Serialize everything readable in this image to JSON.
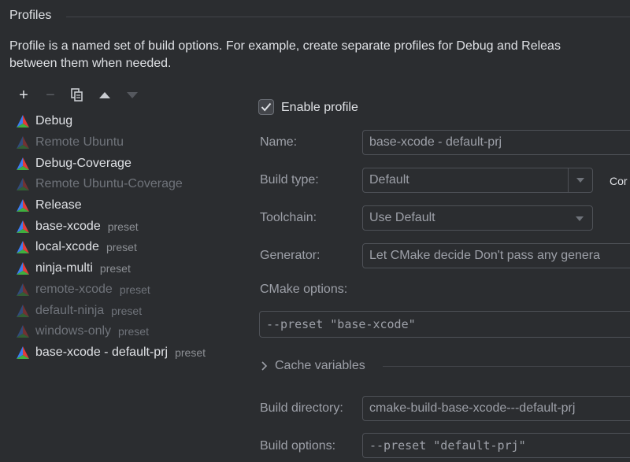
{
  "section": {
    "title": "Profiles",
    "description_line1": "Profile is a named set of build options. For example, create separate profiles for Debug and Releas",
    "description_line2": "between them when needed."
  },
  "toolbar": {
    "add": "+",
    "remove": "−"
  },
  "profiles": [
    {
      "name": "Debug",
      "tag": "",
      "enabled": true
    },
    {
      "name": "Remote Ubuntu",
      "tag": "",
      "enabled": false
    },
    {
      "name": "Debug-Coverage",
      "tag": "",
      "enabled": true
    },
    {
      "name": "Remote Ubuntu-Coverage",
      "tag": "",
      "enabled": false
    },
    {
      "name": "Release",
      "tag": "",
      "enabled": true
    },
    {
      "name": "base-xcode",
      "tag": "preset",
      "enabled": true
    },
    {
      "name": "local-xcode",
      "tag": "preset",
      "enabled": true
    },
    {
      "name": "ninja-multi",
      "tag": "preset",
      "enabled": true
    },
    {
      "name": "remote-xcode",
      "tag": "preset",
      "enabled": false
    },
    {
      "name": "default-ninja",
      "tag": "preset",
      "enabled": false
    },
    {
      "name": "windows-only",
      "tag": "preset",
      "enabled": false
    },
    {
      "name": "base-xcode - default-prj",
      "tag": "preset",
      "enabled": true
    }
  ],
  "form": {
    "enable_profile_label": "Enable profile",
    "enable_profile_checked": true,
    "name_label": "Name:",
    "name_value": "base-xcode - default-prj",
    "build_type_label": "Build type:",
    "build_type_value": "Default",
    "build_type_side_text": "Cor",
    "toolchain_label": "Toolchain:",
    "toolchain_value": "Use  Default",
    "generator_label": "Generator:",
    "generator_value": "Let CMake decide  Don't pass any genera",
    "cmake_options_label": "CMake options:",
    "cmake_options_value": "--preset \"base-xcode\"",
    "cache_variables_label": "Cache variables",
    "build_directory_label": "Build directory:",
    "build_directory_value": "cmake-build-base-xcode---default-prj",
    "build_options_label": "Build options:",
    "build_options_value": "--preset \"default-prj\""
  },
  "colors": {
    "background": "#2b2d30",
    "text": "#dfe1e5",
    "muted": "#9da0a8",
    "disabled": "#6f737a",
    "border": "#4e5157"
  },
  "icons": {
    "profile": "cmake-triangle-icon",
    "copy": "copy-icon",
    "move_up": "arrow-up-icon",
    "move_down": "arrow-down-icon",
    "checkmark": "checkmark-icon",
    "chevron": "chevron-right-icon",
    "dropdown": "chevron-down-icon"
  }
}
